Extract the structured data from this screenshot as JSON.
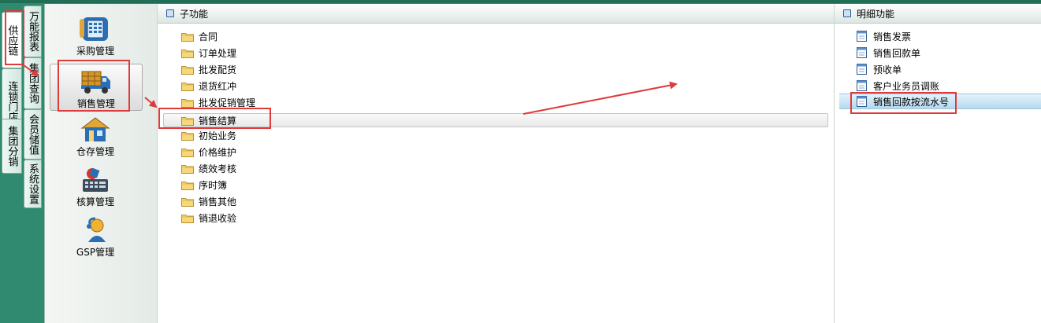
{
  "left_tabs": {
    "col1": [
      {
        "label": "供应链",
        "active": true
      },
      {
        "label": "连锁门店",
        "active": false
      },
      {
        "label": "集团分销",
        "active": false
      }
    ],
    "col2": [
      {
        "label": "万能报表"
      },
      {
        "label": "集团查询"
      },
      {
        "label": "会员储值"
      },
      {
        "label": "系统设置"
      }
    ]
  },
  "modules": [
    {
      "label": "采购管理",
      "icon": "purchase-phone-icon"
    },
    {
      "label": "销售管理",
      "icon": "sales-truck-icon",
      "selected": true
    },
    {
      "label": "仓存管理",
      "icon": "warehouse-house-icon"
    },
    {
      "label": "核算管理",
      "icon": "accounting-machine-icon"
    },
    {
      "label": "GSP管理",
      "icon": "gsp-person-icon"
    }
  ],
  "sub_panel": {
    "title": "子功能",
    "items": [
      "合同",
      "订单处理",
      "批发配货",
      "退货红冲",
      "批发促销管理",
      "销售结算",
      "初始业务",
      "价格维护",
      "绩效考核",
      "序时簿",
      "销售其他",
      "销退收验"
    ],
    "selected": "销售结算"
  },
  "detail_panel": {
    "title": "明细功能",
    "items": [
      "销售发票",
      "销售回款单",
      "预收单",
      "客户业务员调账",
      "销售回款按流水号"
    ],
    "selected": "销售回款按流水号"
  },
  "colors": {
    "background": "#2f8a6f",
    "highlight": "#e03a3a",
    "selected_row": "#b6d9ee"
  }
}
